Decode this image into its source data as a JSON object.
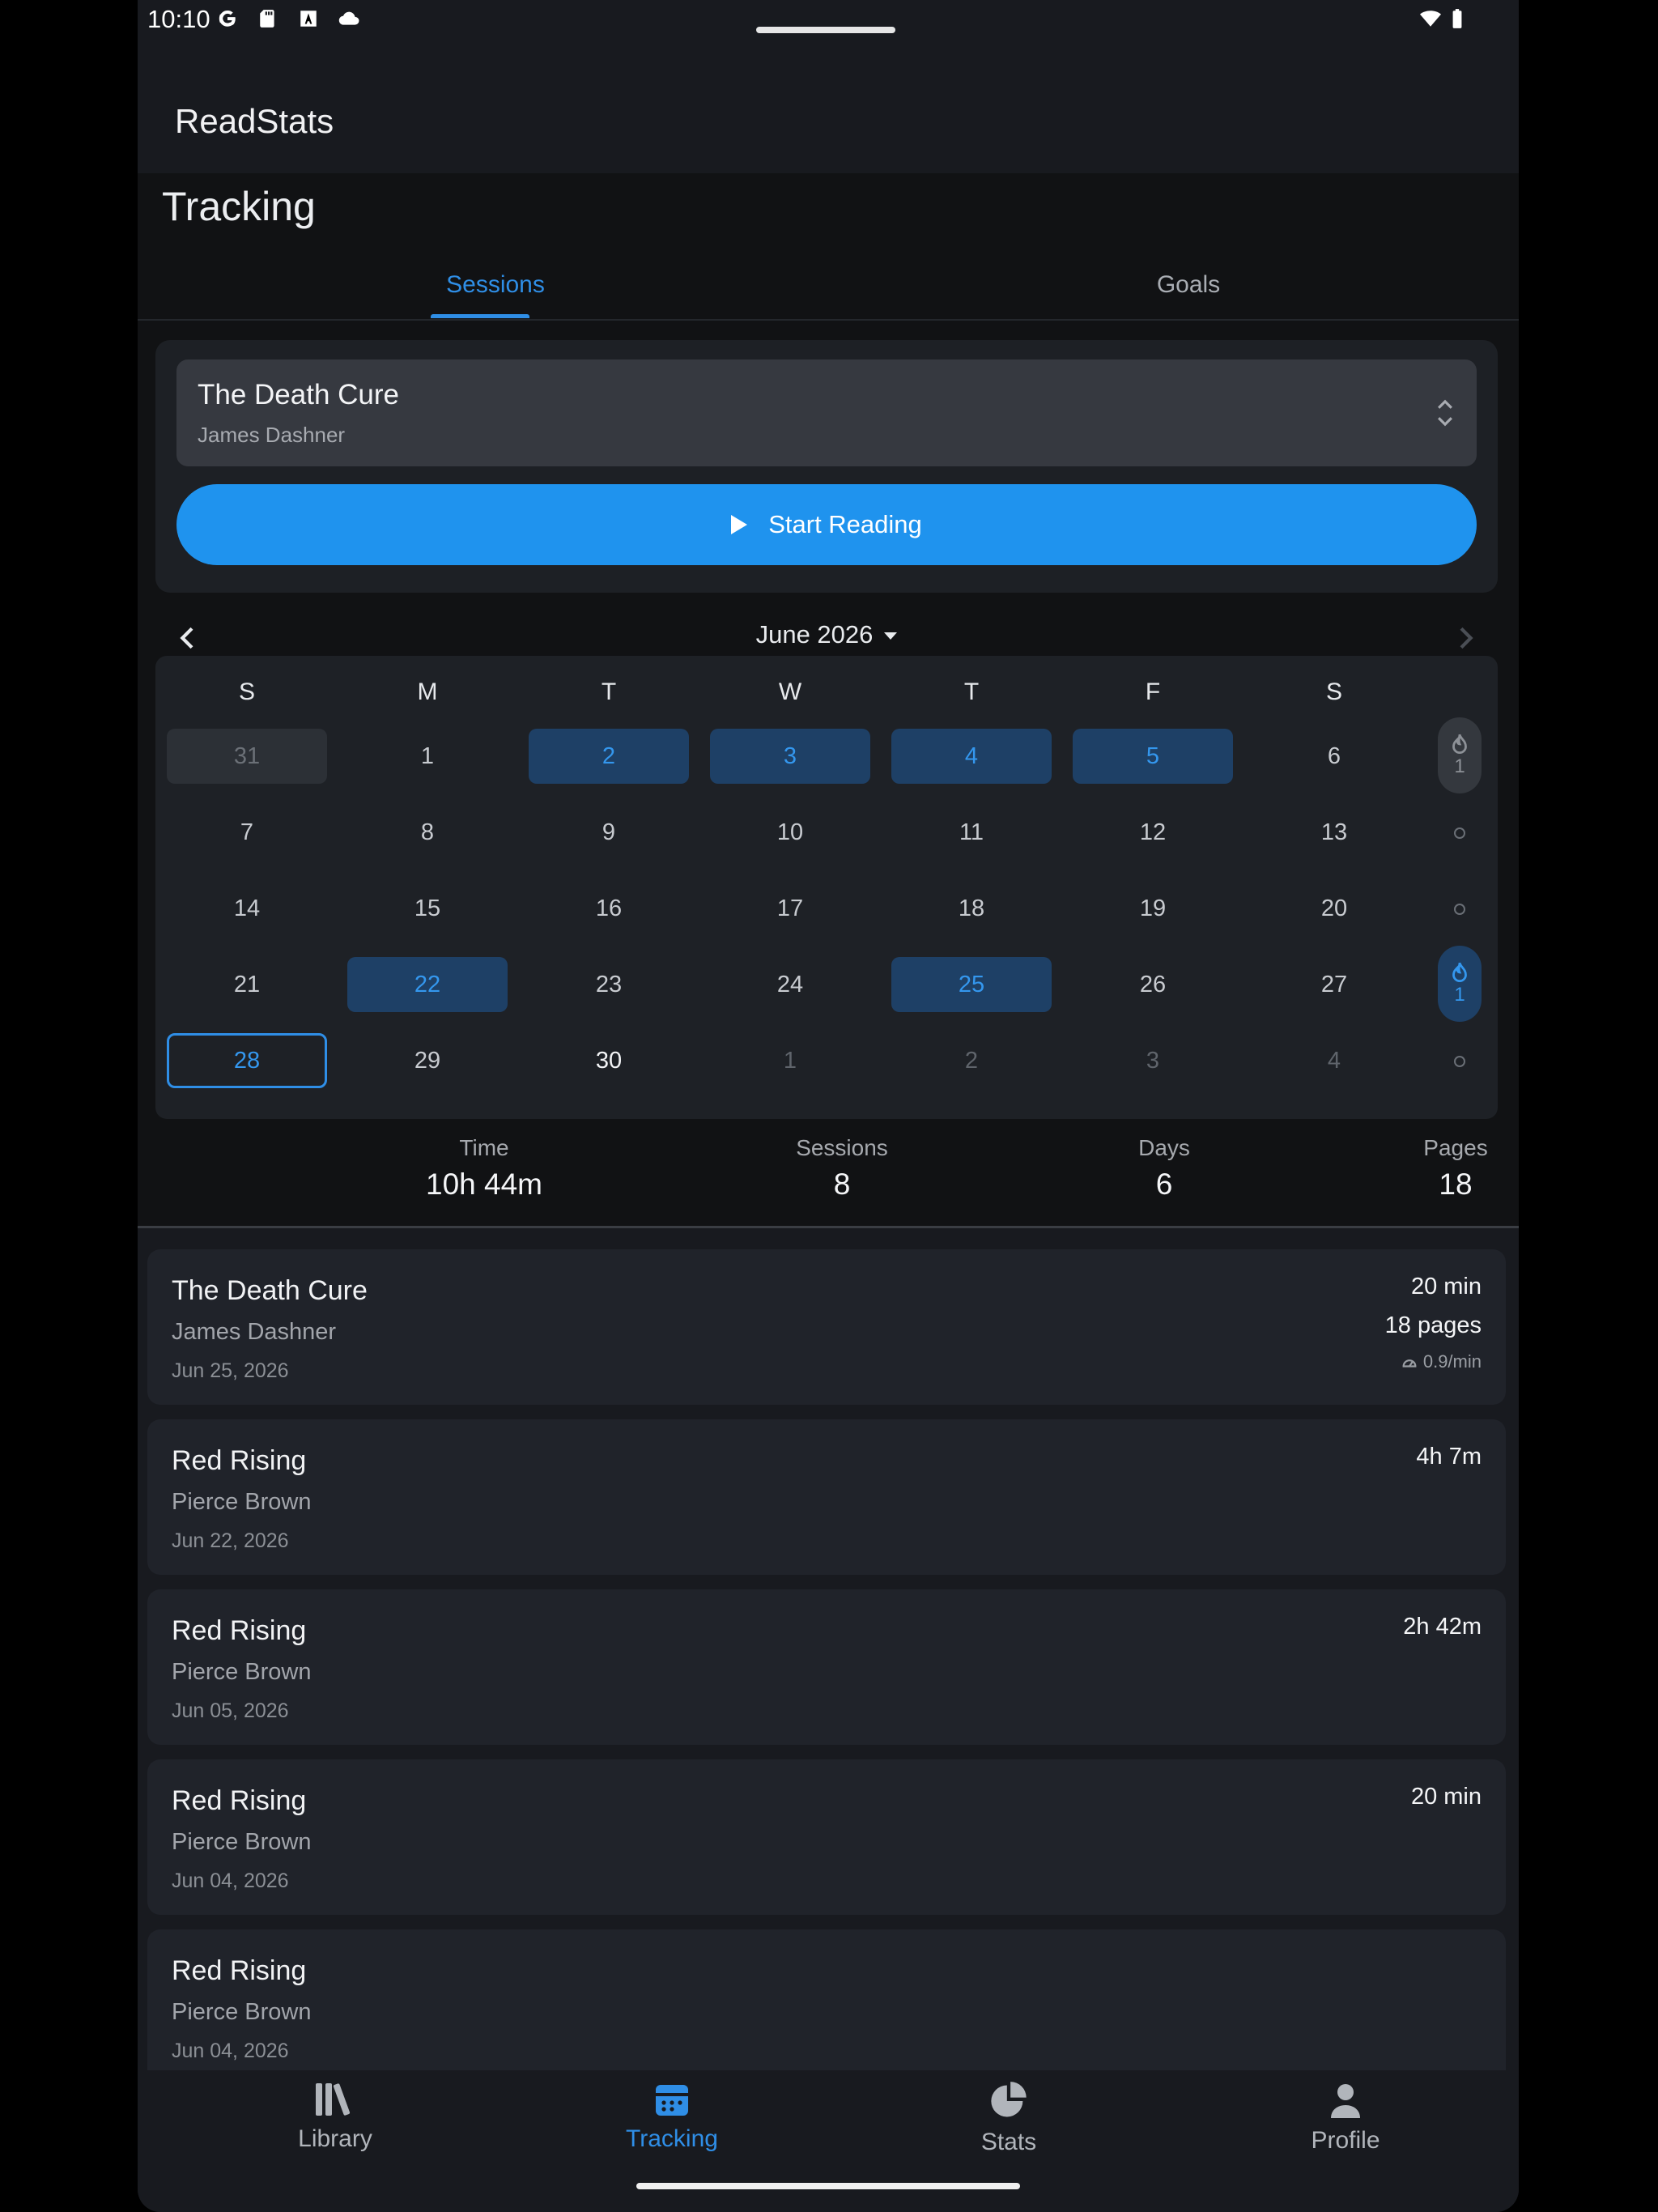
{
  "status_bar": {
    "time": "10:10"
  },
  "app": {
    "title": "ReadStats"
  },
  "page": {
    "title": "Tracking"
  },
  "tabs": [
    {
      "label": "Sessions"
    },
    {
      "label": "Goals"
    }
  ],
  "current_book": {
    "title": "The Death Cure",
    "author": "James Dashner"
  },
  "start_button": {
    "label": "Start Reading"
  },
  "calendar": {
    "month_label": "June 2026",
    "weekdays": [
      "S",
      "M",
      "T",
      "W",
      "T",
      "F",
      "S"
    ],
    "weeks": [
      [
        "31",
        "1",
        "2",
        "3",
        "4",
        "5",
        "6"
      ],
      [
        "7",
        "8",
        "9",
        "10",
        "11",
        "12",
        "13"
      ],
      [
        "14",
        "15",
        "16",
        "17",
        "18",
        "19",
        "20"
      ],
      [
        "21",
        "22",
        "23",
        "24",
        "25",
        "26",
        "27"
      ],
      [
        "28",
        "29",
        "30",
        "1",
        "2",
        "3",
        "4"
      ]
    ],
    "week_streaks": [
      "1",
      "",
      "",
      "1",
      ""
    ]
  },
  "summary": {
    "time_label": "Time",
    "time_value": "10h 44m",
    "sessions_label": "Sessions",
    "sessions_value": "8",
    "days_label": "Days",
    "days_value": "6",
    "pages_label": "Pages",
    "pages_value": "18"
  },
  "sessions": [
    {
      "title": "The Death Cure",
      "author": "James Dashner",
      "date": "Jun 25, 2026",
      "duration": "20 min",
      "pages": "18 pages",
      "speed": "0.9/min"
    },
    {
      "title": "Red Rising",
      "author": "Pierce Brown",
      "date": "Jun 22, 2026",
      "duration": "4h 7m"
    },
    {
      "title": "Red Rising",
      "author": "Pierce Brown",
      "date": "Jun 05, 2026",
      "duration": "2h 42m"
    },
    {
      "title": "Red Rising",
      "author": "Pierce Brown",
      "date": "Jun 04, 2026",
      "duration": "20 min"
    },
    {
      "title": "Red Rising",
      "author": "Pierce Brown",
      "date": "Jun 04, 2026",
      "duration": ""
    }
  ],
  "fab": {
    "label": "+"
  },
  "bottom_nav": [
    {
      "label": "Library",
      "icon": "library-icon"
    },
    {
      "label": "Tracking",
      "icon": "calendar-icon"
    },
    {
      "label": "Stats",
      "icon": "pie-chart-icon"
    },
    {
      "label": "Profile",
      "icon": "person-icon"
    }
  ],
  "colors": {
    "accent": "#1f93ee",
    "background": "#181a1f",
    "highlight_day": "#1e4066"
  }
}
